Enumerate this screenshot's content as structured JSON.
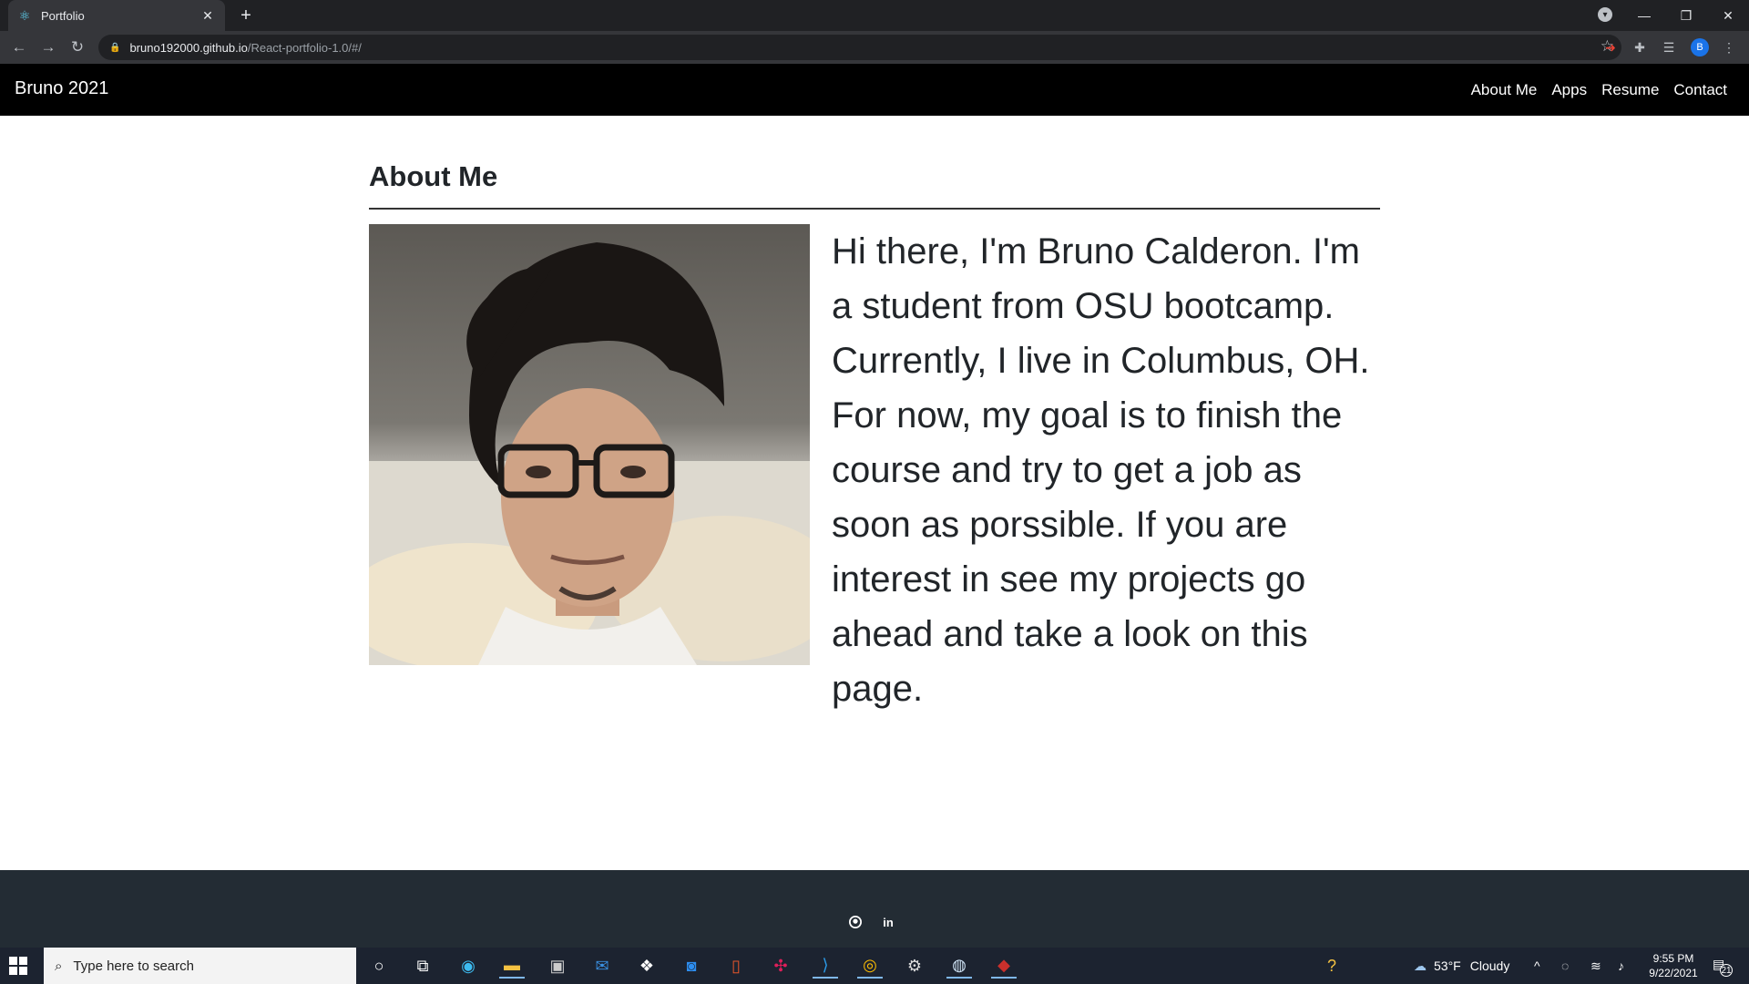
{
  "browser": {
    "tab_title": "Portfolio",
    "url_host": "bruno192000.github.io",
    "url_path": "/React-portfolio-1.0/#/",
    "profile_initial": "B",
    "icons": [
      "react-favicon",
      "close-icon",
      "plus-icon",
      "back-icon",
      "forward-icon",
      "reload-icon",
      "lock-icon",
      "star-icon",
      "extensions-icon",
      "reading-list-icon"
    ]
  },
  "navbar": {
    "brand": "Bruno 2021",
    "links": [
      "About Me",
      "Apps",
      "Resume",
      "Contact"
    ]
  },
  "about": {
    "title": "About Me",
    "bio": "Hi there, I'm Bruno Calderon. I'm a student from OSU bootcamp. Currently, I live in Columbus, OH. For now, my goal is to finish the course and try to get a job as soon as porssible. If you are interest in see my projects go ahead and take a look on this page."
  },
  "footer": {
    "icons": [
      "github-icon",
      "linkedin-icon"
    ],
    "linkedin_glyph": "in"
  },
  "taskbar": {
    "search_placeholder": "Type here to search",
    "weather_temp": "53°F",
    "weather_text": "Cloudy",
    "time": "9:55 PM",
    "date": "9/22/2021",
    "notification_count": "21"
  },
  "colors": {
    "navbar_bg": "#000000",
    "footer_bg": "#232c34",
    "text": "#212529"
  }
}
